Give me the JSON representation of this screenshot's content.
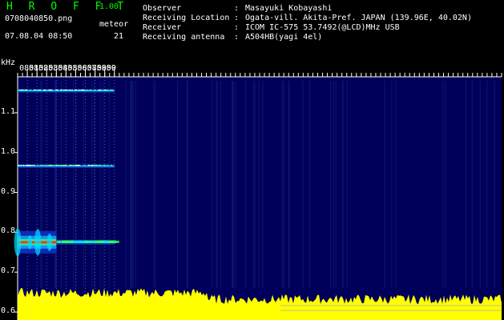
{
  "header": {
    "app_title": "H R O F F T",
    "app_version": "1.00",
    "file_name": "0708040850.png",
    "date_time": "07.08.04 08:50",
    "meteor_label": "meteor",
    "meteor_count": "21",
    "info": [
      {
        "key": "Observer",
        "value": "Masayuki Kobayashi"
      },
      {
        "key": "Receiving Location",
        "value": "Ogata-vill. Akita-Pref. JAPAN (139.96E, 40.02N)"
      },
      {
        "key": "Receiver",
        "value": "ICOM IC-575 53.7492(@LCD)MHz USB"
      },
      {
        "key": "Receiving antenna",
        "value": "A504HB(yagi 4el)"
      }
    ]
  },
  "colors": {
    "background": "#000000",
    "spectrogram_bg": "#00005a",
    "title_green": "#00ff00",
    "signal_red": "#ff3030",
    "signal_cyan": "#00e0ff",
    "signal_green": "#30ff60",
    "audio_level_yellow": "#ffff00"
  },
  "chart_data": {
    "type": "heatmap",
    "ylabel": "kHz",
    "x_ticks": [
      "0851",
      "0852",
      "0853",
      "0854",
      "0855",
      "0856",
      "0857",
      "0858",
      "0859",
      "0900"
    ],
    "y_ticks": [
      "1.1",
      "1.0",
      "0.9",
      "0.8",
      "0.7",
      "0.6"
    ],
    "ylim": [
      0.58,
      1.19
    ],
    "xlim": [
      "0850",
      "0900"
    ],
    "traces": [
      {
        "label_freq_khz": 1.155,
        "extent": [
          "0850",
          "0900"
        ]
      },
      {
        "label_freq_khz": 0.966,
        "extent": [
          "0850",
          "0900"
        ]
      },
      {
        "label_freq_khz": 0.775,
        "extent": [
          "0850",
          "0900"
        ],
        "strong_until": "0854"
      }
    ]
  }
}
